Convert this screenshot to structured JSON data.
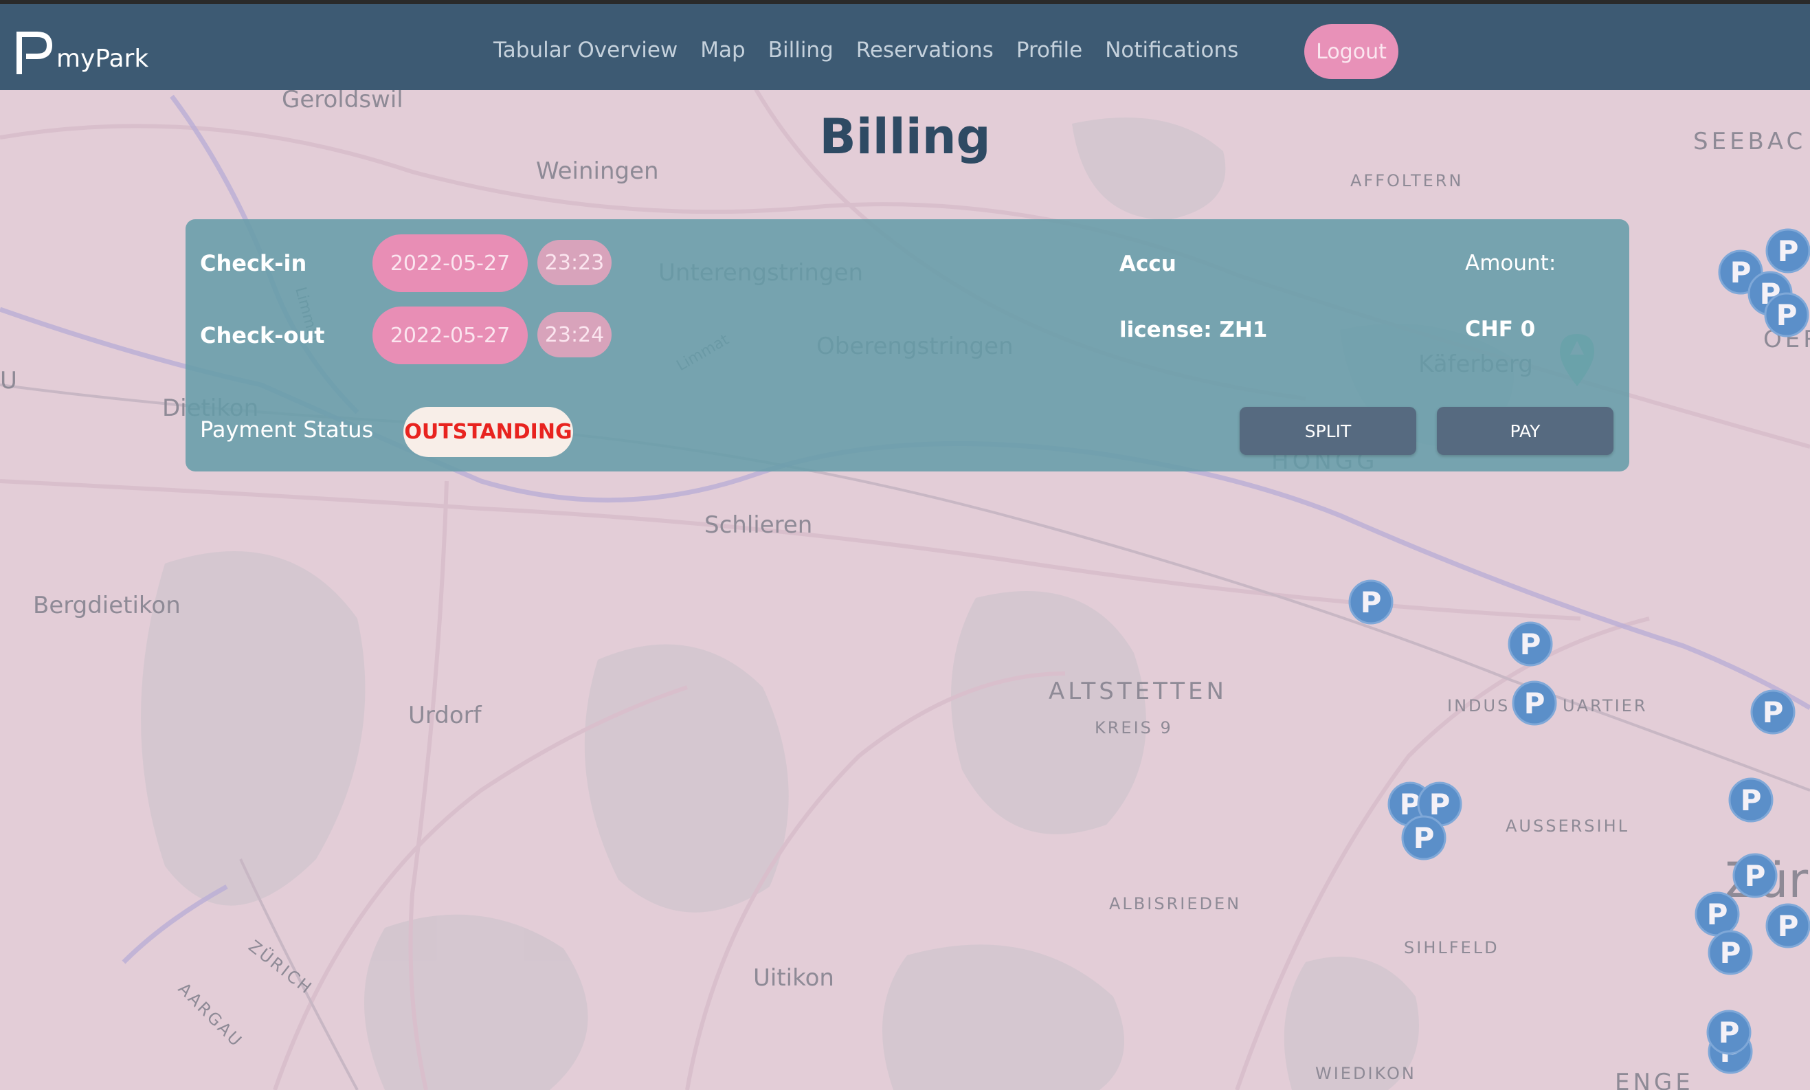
{
  "nav": {
    "brand": "myPark",
    "links": [
      "Tabular Overview",
      "Map",
      "Billing",
      "Reservations",
      "Profile",
      "Notifications"
    ],
    "logout": "Logout"
  },
  "page": {
    "title": "Billing"
  },
  "billing": {
    "checkin_label": "Check-in",
    "checkin_date": "2022-05-27",
    "checkin_time": "23:23",
    "checkout_label": "Check-out",
    "checkout_date": "2022-05-27",
    "checkout_time": "23:24",
    "name": "Accu",
    "license": "license: ZH1",
    "amount_label": "Amount:",
    "amount": "CHF 0",
    "payment_status_label": "Payment Status",
    "payment_status": "OUTSTANDING",
    "split_label": "SPLIT",
    "pay_label": "PAY"
  },
  "map": {
    "places": [
      "Geroldswil",
      "Weiningen",
      "Unterengstringen",
      "Oberengstringen",
      "Dietikon",
      "Schlieren",
      "Bergdietikon",
      "Urdorf",
      "Uitikon",
      "Käferberg"
    ],
    "districts": [
      "ALTSTETTEN",
      "KREIS 9",
      "AFFOLTERN",
      "SEEBAC",
      "HÖNGG",
      "INDUS",
      "UARTIER",
      "AUSSERSIHL",
      "ALBISRIEDEN",
      "SIHLFELD",
      "WIEDIKON",
      "ENGE",
      "OER"
    ],
    "road_labels": [
      "ZÜRICH",
      "AARGAU",
      "Limmat"
    ],
    "city_partial": "Züri",
    "parking_marker": "P"
  },
  "colors": {
    "navbar": "#3d5a73",
    "card": "#649ca8",
    "pill": "#e88eb5",
    "logout": "#e891b8",
    "outstanding": "#e8231f",
    "button": "#566a80",
    "marker": "#5b8fc9"
  }
}
